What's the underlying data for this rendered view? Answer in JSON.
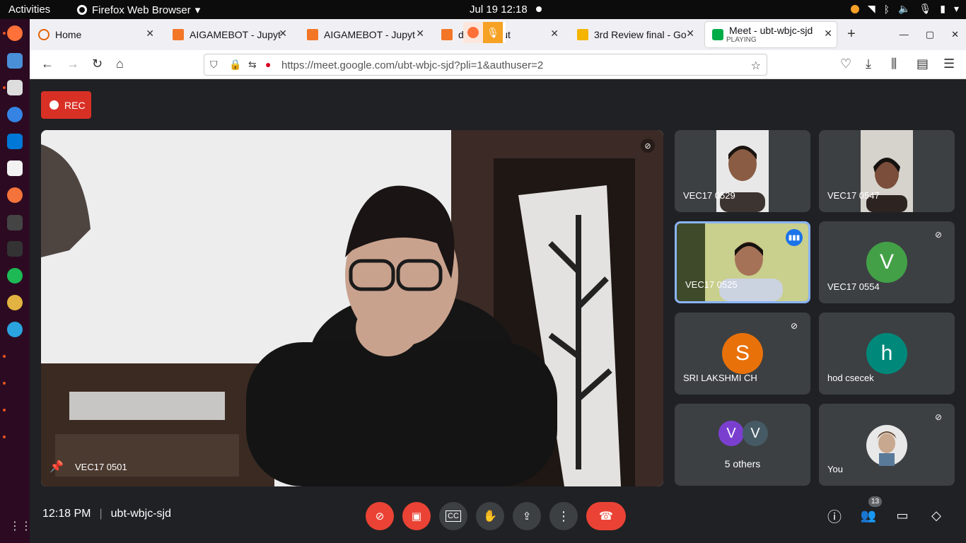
{
  "topbar": {
    "activities": "Activities",
    "app_name": "Firefox Web Browser",
    "clock": "Jul 19  12:18"
  },
  "tabs": [
    {
      "label": "Home"
    },
    {
      "label": "AIGAMEBOT - Jupyt"
    },
    {
      "label": "AIGAMEBOT - Jupyt"
    },
    {
      "label": "d          _breakout"
    },
    {
      "label": "3rd Review final - Go"
    },
    {
      "label": "Meet - ubt-wbjc-sjd",
      "status": "PLAYING"
    }
  ],
  "url": {
    "text": "https://meet.google.com/ubt-wbjc-sjd?pli=1&authuser=2",
    "host_bold": "google.com"
  },
  "meet": {
    "rec_label": "REC",
    "main_participant": "VEC17 0501",
    "participants": [
      {
        "name": "VEC17 0529",
        "type": "video"
      },
      {
        "name": "VEC17 0547",
        "type": "video"
      },
      {
        "name": "VEC17 0525",
        "type": "video",
        "speaking": true
      },
      {
        "name": "VEC17 0554",
        "initial": "V",
        "color": "#43a047",
        "muted": true
      },
      {
        "name": "SRI LAKSHMI CH",
        "initial": "S",
        "color": "#e8710a",
        "muted": true
      },
      {
        "name": "hod csecek",
        "initial": "h",
        "color": "#00897b"
      },
      {
        "name": "5 others",
        "initials": [
          "V",
          "V"
        ]
      },
      {
        "name": "You",
        "muted": true
      }
    ],
    "time": "12:18 PM",
    "meeting_code": "ubt-wbjc-sjd",
    "people_count": "13"
  },
  "colors": {
    "red": "#ea4335",
    "tile": "#3c4043",
    "bg": "#202124",
    "accent": "#8ab4f8"
  }
}
